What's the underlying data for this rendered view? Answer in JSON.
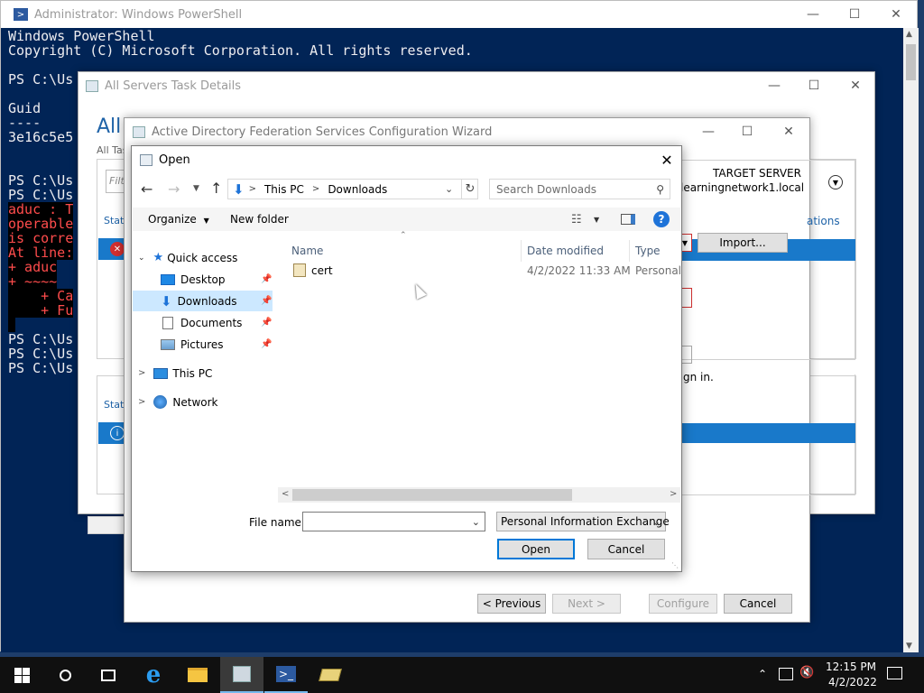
{
  "powershell": {
    "title": "Administrator: Windows PowerShell",
    "lines": [
      "Windows PowerShell",
      "Copyright (C) Microsoft Corporation. All rights reserved.",
      "",
      "PS C:\\Us",
      "",
      "Guid",
      "----",
      "3e16c5e5",
      "",
      "",
      "PS C:\\Us",
      "PS C:\\Us"
    ],
    "error_lines": [
      "aduc : T",
      "operable",
      "is corre",
      "At line:",
      "+ aduc",
      "+ ~~~~",
      "    + Ca",
      "    + Fu"
    ],
    "tail_lines": [
      "PS C:\\Us",
      "PS C:\\Us",
      "PS C:\\Us"
    ]
  },
  "task_details": {
    "title": "All Servers Task Details",
    "heading": "All",
    "subheading": "All Tas",
    "filter_placeholder": "Filt",
    "status_col": "Statu",
    "status_col2": "Statu"
  },
  "wizard": {
    "title": "Active Directory Federation Services Configuration Wizard",
    "target_server_label": "TARGET SERVER",
    "target_server_value": "learningnetwork1.local",
    "options_fragment": "ations",
    "import_button": "Import...",
    "sign_in_fragment": "gn in.",
    "previous_button": "< Previous",
    "next_button": "Next >",
    "configure_button": "Configure",
    "cancel_button": "Cancel"
  },
  "open_dialog": {
    "title": "Open",
    "breadcrumb": [
      "This PC",
      "Downloads"
    ],
    "search_placeholder": "Search Downloads",
    "organize": "Organize",
    "new_folder": "New folder",
    "nav": {
      "quick_access": "Quick access",
      "desktop": "Desktop",
      "downloads": "Downloads",
      "documents": "Documents",
      "pictures": "Pictures",
      "this_pc": "This PC",
      "network": "Network"
    },
    "columns": {
      "name": "Name",
      "date_modified": "Date modified",
      "type": "Type"
    },
    "files": [
      {
        "name": "cert",
        "date": "4/2/2022 11:33 AM",
        "type": "Personal I"
      }
    ],
    "file_name_label": "File name:",
    "file_name_value": "",
    "file_type": "Personal Information Exchange",
    "open_button": "Open",
    "cancel_button": "Cancel"
  },
  "taskbar": {
    "time": "12:15 PM",
    "date": "4/2/2022"
  }
}
